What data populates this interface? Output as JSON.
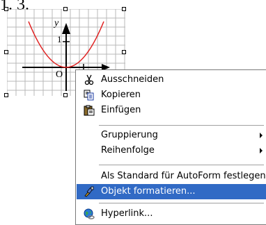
{
  "heading": "1. 3.",
  "graph": {
    "y_label": "y",
    "tick_label": "1",
    "origin_label": "O",
    "curve_color": "#e02020"
  },
  "context_menu": {
    "items": [
      {
        "name": "cut-menu-item",
        "label": "Ausschneiden",
        "icon": "scissors-icon",
        "submenu": false,
        "selected": false
      },
      {
        "name": "copy-menu-item",
        "label": "Kopieren",
        "icon": "copy-icon",
        "submenu": false,
        "selected": false
      },
      {
        "name": "paste-menu-item",
        "label": "Einfügen",
        "icon": "paste-icon",
        "submenu": false,
        "selected": false
      },
      {
        "name": "grouping-menu-item",
        "label": "Gruppierung",
        "icon": "",
        "submenu": true,
        "selected": false
      },
      {
        "name": "order-menu-item",
        "label": "Reihenfolge",
        "icon": "",
        "submenu": true,
        "selected": false
      },
      {
        "name": "set-autoform-default-menu-item",
        "label": "Als Standard für AutoForm festlegen",
        "icon": "",
        "submenu": false,
        "selected": false
      },
      {
        "name": "format-object-menu-item",
        "label": "Objekt formatieren...",
        "icon": "format-brush-icon",
        "submenu": false,
        "selected": true
      },
      {
        "name": "hyperlink-menu-item",
        "label": "Hyperlink...",
        "icon": "globe-link-icon",
        "submenu": false,
        "selected": false
      }
    ]
  },
  "colors": {
    "highlight": "#316ac5",
    "grid": "#b8b8b8"
  }
}
